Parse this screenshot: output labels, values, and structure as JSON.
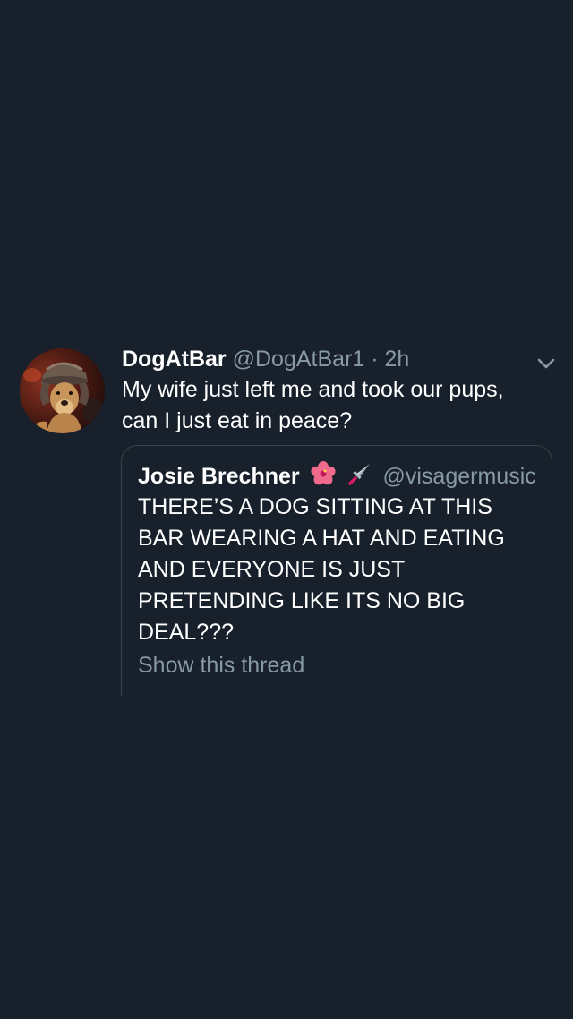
{
  "tweet": {
    "display_name": "DogAtBar",
    "handle": "@DogAtBar1",
    "separator": "·",
    "time": "2h",
    "text": "My wife just left me and took our pups, can I just eat in peace?",
    "avatar_icon": "dog-in-hat-avatar",
    "menu_icon": "chevron-down-icon"
  },
  "quoted_tweet": {
    "display_name": "Josie Brechner",
    "emojis": [
      "hibiscus-icon",
      "dagger-icon"
    ],
    "handle": "@visagermusic",
    "text": "THERE’S A DOG SITTING AT THIS BAR WEARING A HAT AND EATING AND EVERYONE IS JUST PRETENDING LIKE ITS NO BIG DEAL???",
    "show_thread_label": "Show this thread"
  },
  "colors": {
    "background": "#17202b",
    "primary_text": "#ffffff",
    "secondary_text": "#8899a6",
    "border": "#38444d"
  }
}
